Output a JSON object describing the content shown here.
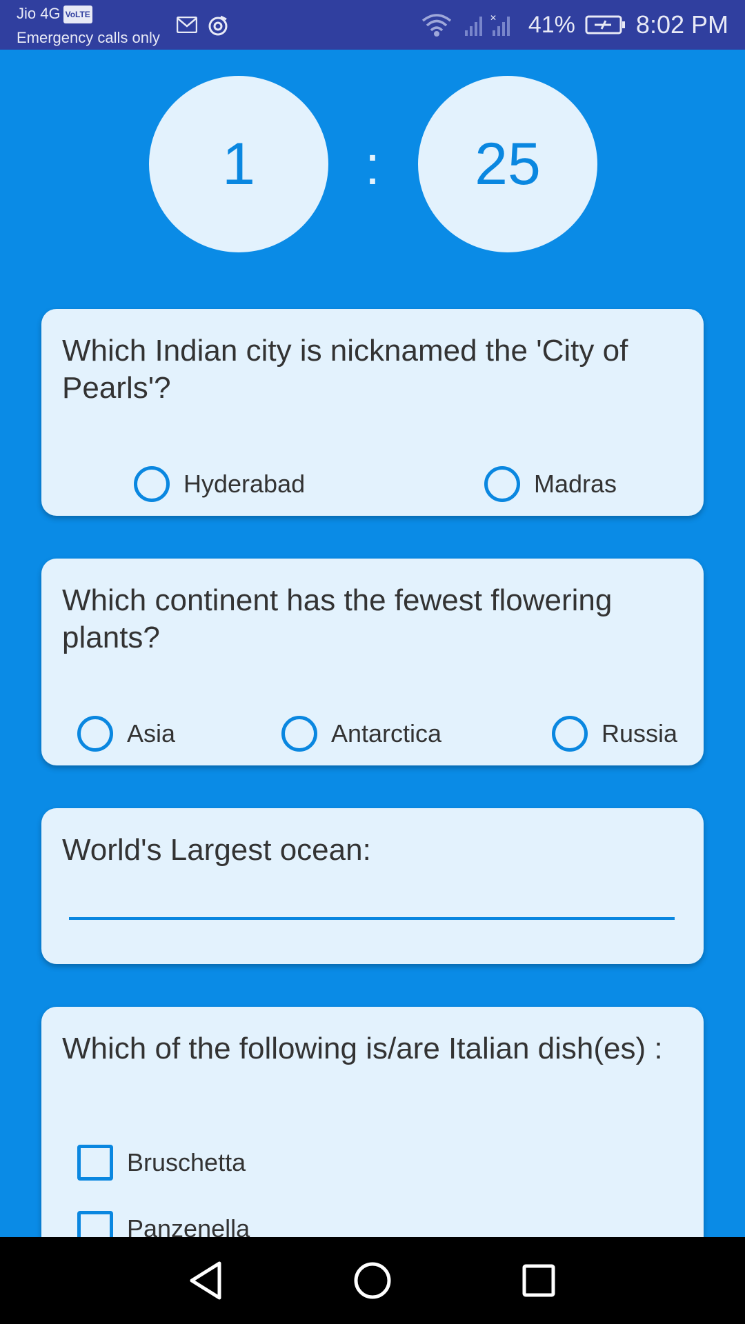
{
  "status_bar": {
    "carrier": "Jio 4G",
    "volte": "VoLTE",
    "emergency": "Emergency calls only",
    "battery": "41%",
    "time": "8:02 PM",
    "icons": [
      "gmail-icon",
      "sync-icon",
      "wifi-icon",
      "signal-icon",
      "battery-icon"
    ]
  },
  "timer": {
    "minutes": "1",
    "separator": ":",
    "seconds": "25"
  },
  "questions": [
    {
      "text": "Which Indian city is nicknamed the 'City of Pearls'?",
      "type": "radio",
      "options": [
        "Hyderabad",
        "Madras"
      ]
    },
    {
      "text": "Which continent has the fewest flowering plants?",
      "type": "radio",
      "options": [
        "Asia",
        "Antarctica",
        "Russia"
      ]
    },
    {
      "text": "World's Largest ocean:",
      "type": "text",
      "value": ""
    },
    {
      "text": "Which of the following is/are Italian dish(es) :",
      "type": "checkbox",
      "options": [
        "Bruschetta",
        "Panzenella"
      ]
    }
  ],
  "colors": {
    "background": "#0a8be6",
    "card": "#e3f2fd",
    "accent": "#0a87e0",
    "status_bar": "#303f9f"
  }
}
